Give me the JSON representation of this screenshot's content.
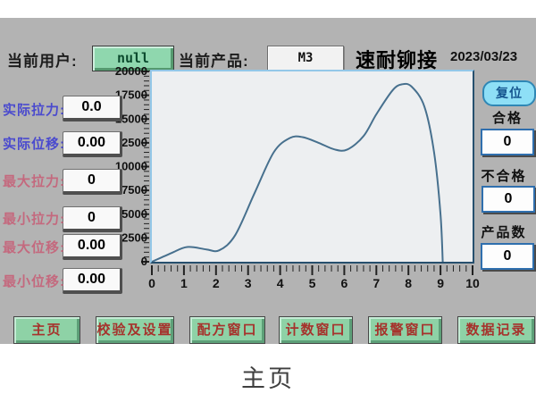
{
  "header": {
    "current_user_label": "当前用户:",
    "current_user_value": "null",
    "current_product_label": "当前产品:",
    "current_product_value": "M3",
    "brand": "速耐铆接",
    "date": "2023/03/23"
  },
  "readouts": [
    {
      "label": "实际拉力:",
      "value": "0.0"
    },
    {
      "label": "实际位移:",
      "value": "0.00"
    },
    {
      "label": "最大拉力:",
      "value": "0"
    },
    {
      "label": "最小拉力:",
      "value": "0"
    },
    {
      "label": "最大位移:",
      "value": "0.00"
    },
    {
      "label": "最小位移:",
      "value": "0.00"
    }
  ],
  "counters": {
    "reset_button_label": "复位",
    "items": [
      {
        "label": "合格",
        "value": "0"
      },
      {
        "label": "不合格",
        "value": "0"
      },
      {
        "label": "产品数",
        "value": "0"
      }
    ]
  },
  "nav_buttons": [
    "主页",
    "校验及设置",
    "配方窗口",
    "计数窗口",
    "报警窗口",
    "数据记录"
  ],
  "caption": "主页",
  "chart_data": {
    "type": "line",
    "title": "",
    "xlabel": "",
    "ylabel": "",
    "x": [
      0,
      0.6,
      1.1,
      1.7,
      2.1,
      2.6,
      3.2,
      3.8,
      4.3,
      4.7,
      5.2,
      5.7,
      6.1,
      6.6,
      7.0,
      7.5,
      7.8,
      8.1,
      8.5,
      8.8,
      9.0,
      9.07
    ],
    "y": [
      0,
      900,
      1550,
      1300,
      1200,
      2800,
      7200,
      11500,
      13000,
      13100,
      12500,
      11800,
      11800,
      13200,
      15500,
      18000,
      18650,
      18400,
      16300,
      11500,
      5000,
      0
    ],
    "xlim": [
      0,
      10
    ],
    "ylim": [
      0,
      20000
    ],
    "x_tick_step": 1,
    "y_tick_step": 2500,
    "x_minor_step": 0.2,
    "y_minor_step": 500,
    "grid": false,
    "legend": null,
    "line_color": "#47708e"
  },
  "colors": {
    "panel_bg": "#b3b3b3",
    "green_button_bg": "#8ed2a6",
    "nav_text_red": "#a6322c",
    "reset_button_bg": "#8edff6",
    "counter_border_blue": "#2f6fae",
    "chart_frame_blue": "#93c7e8",
    "chart_bg": "#edeff1",
    "curve_color": "#47708e",
    "readout_label_blue": "#4a4ace",
    "readout_label_rose": "#c4697e"
  }
}
